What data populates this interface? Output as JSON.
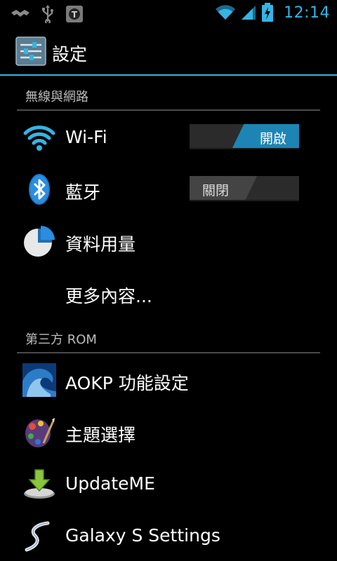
{
  "status_bar": {
    "time": "12:14",
    "icons": [
      "handshake-icon",
      "usb-icon",
      "debug-gear-icon",
      "wifi-signal-icon",
      "cell-signal-icon",
      "battery-charging-icon"
    ]
  },
  "action_bar": {
    "title": "設定",
    "icon": "settings-sliders-icon",
    "accent": "#33b5e5"
  },
  "sections": [
    {
      "header": "無線與網路",
      "items": [
        {
          "label": "Wi-Fi",
          "icon": "wifi-icon",
          "toggle": {
            "state": "on",
            "label": "開啟"
          }
        },
        {
          "label": "藍牙",
          "icon": "bluetooth-icon",
          "toggle": {
            "state": "off",
            "label": "關閉"
          }
        },
        {
          "label": "資料用量",
          "icon": "data-usage-pie-icon"
        },
        {
          "label": "更多內容..."
        }
      ]
    },
    {
      "header": "第三方 ROM",
      "items": [
        {
          "label": "AOKP 功能設定",
          "icon": "wave-icon"
        },
        {
          "label": "主題選擇",
          "icon": "palette-icon"
        },
        {
          "label": "UpdateME",
          "icon": "download-arrow-icon"
        },
        {
          "label": "Galaxy S Settings",
          "icon": "galaxy-s-icon"
        }
      ]
    }
  ]
}
